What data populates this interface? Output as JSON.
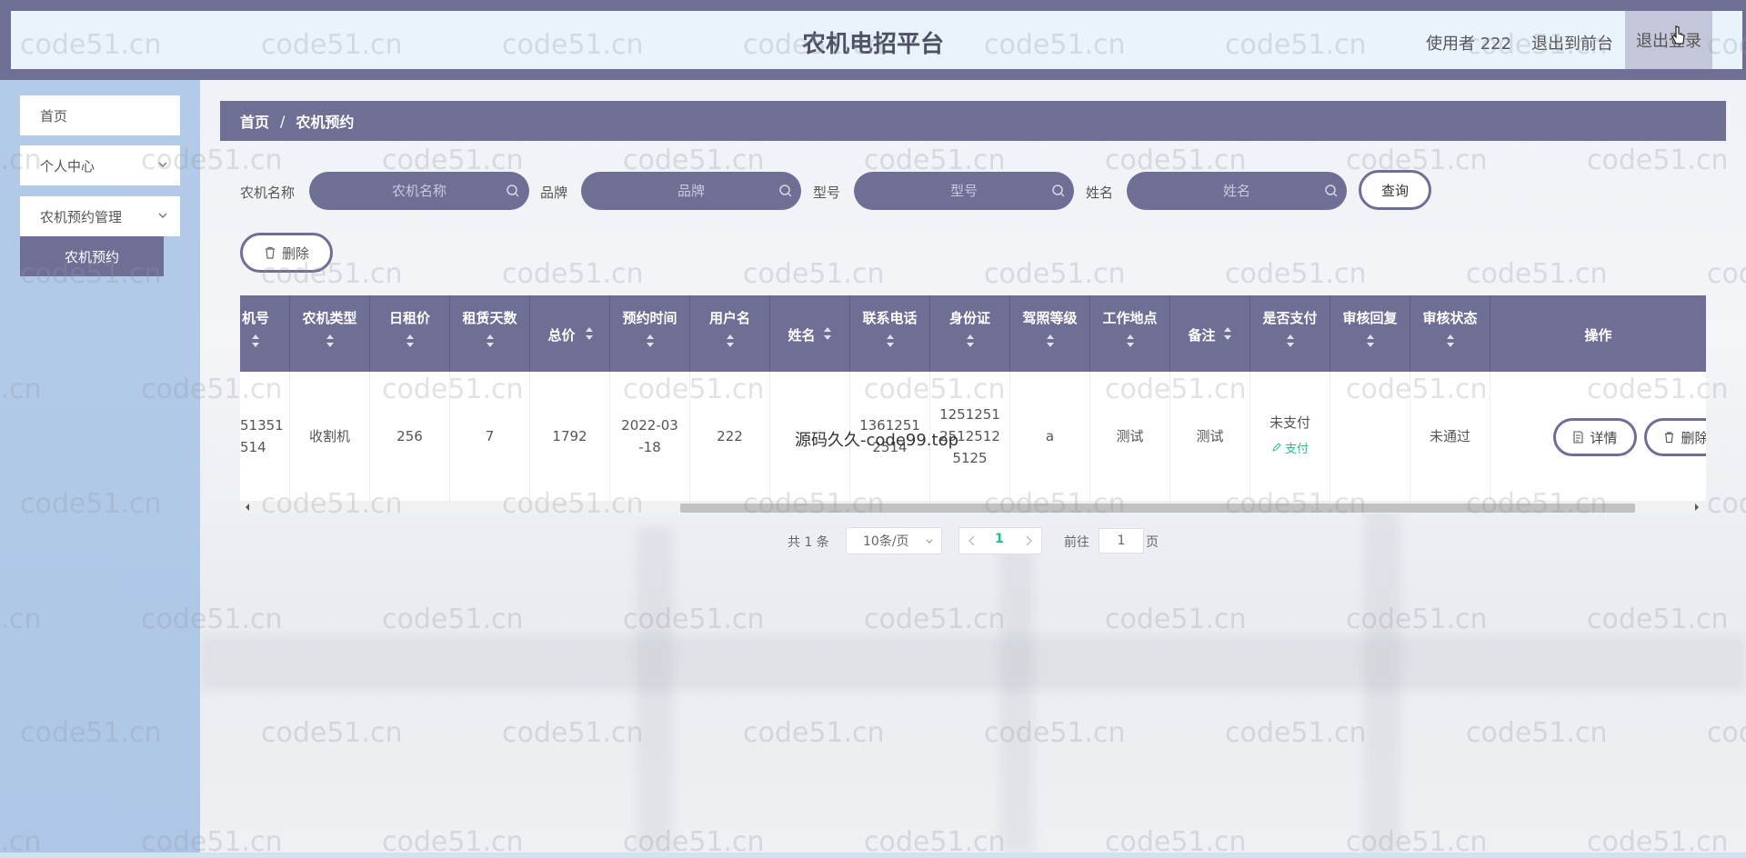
{
  "header": {
    "title": "农机电招平台",
    "user_label": "使用者 222",
    "to_front": "退出到前台",
    "logout": "退出登录"
  },
  "sidebar": {
    "items": [
      {
        "label": "首页"
      },
      {
        "label": "个人中心"
      },
      {
        "label": "农机预约管理"
      }
    ],
    "subitem": "农机预约"
  },
  "breadcrumb": {
    "home": "首页",
    "sep": "/",
    "current": "农机预约"
  },
  "search": {
    "fields": [
      {
        "label": "农机名称",
        "placeholder": "农机名称"
      },
      {
        "label": "品牌",
        "placeholder": "品牌"
      },
      {
        "label": "型号",
        "placeholder": "型号"
      },
      {
        "label": "姓名",
        "placeholder": "姓名"
      }
    ],
    "query_button": "查询"
  },
  "toolbar": {
    "delete_label": "删除"
  },
  "table": {
    "headers": [
      "机号",
      "农机类型",
      "日租价",
      "租赁天数",
      "总价",
      "预约时间",
      "用户名",
      "姓名",
      "联系电话",
      "身份证",
      "驾照等级",
      "工作地点",
      "备注",
      "是否支付",
      "审核回复",
      "审核状态",
      "操作"
    ],
    "row": {
      "machine_no_1": "51351",
      "machine_no_2": "514",
      "type": "收割机",
      "daily_price": "256",
      "days": "7",
      "total": "1792",
      "time_1": "2022-03",
      "time_2": "-18",
      "username": "222",
      "name": "",
      "phone_1": "1361251",
      "phone_2": "2514",
      "id_1": "1251251",
      "id_2": "2512512",
      "id_3": "5125",
      "license": "a",
      "location": "测试",
      "remark": "测试",
      "paid": "未支付",
      "pay_action": "支付",
      "reply": "",
      "status": "未通过",
      "detail_btn": "详情",
      "delete_btn": "删除"
    }
  },
  "overlay_text": "源码久久-code99.top",
  "pagination": {
    "total": "共 1 条",
    "page_size": "10条/页",
    "current": "1",
    "goto_label": "前往",
    "goto_value": "1",
    "unit": "页"
  },
  "watermark": "code51.cn",
  "colors": {
    "primary": "#6f6f95",
    "sidebar": "#b2cbe8",
    "header_inner": "#e8f3fb",
    "pay": "#2fb88a"
  }
}
